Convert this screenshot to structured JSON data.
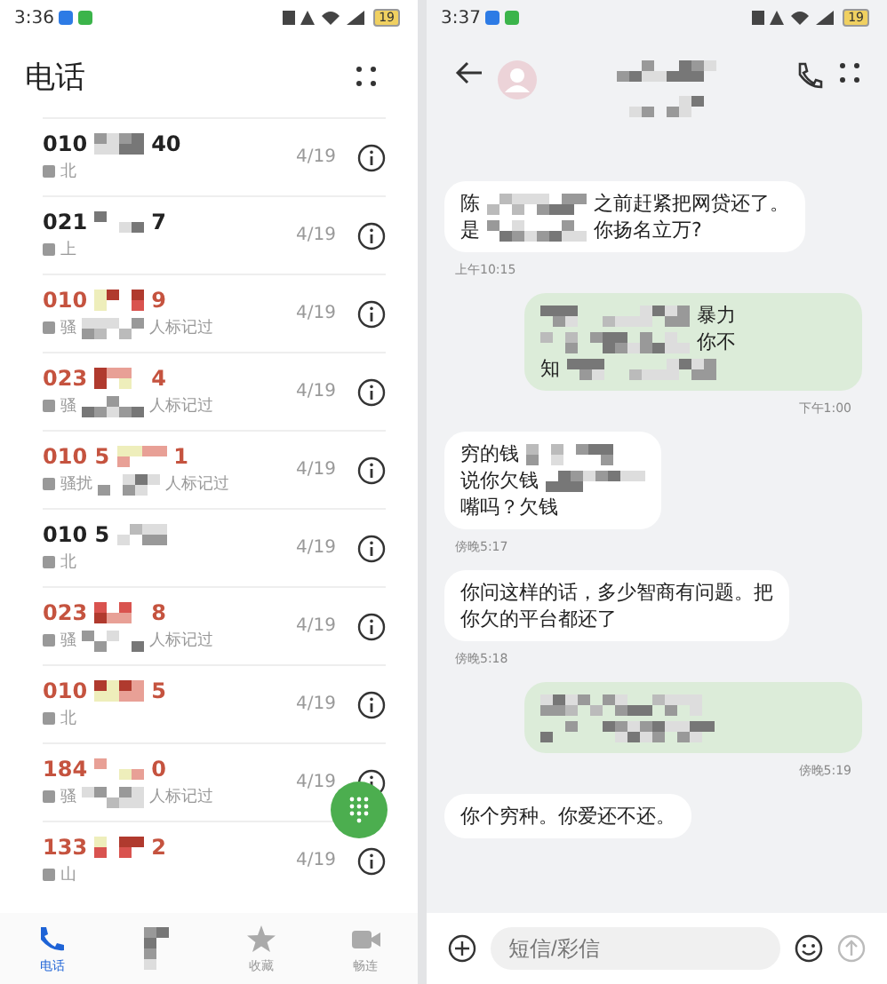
{
  "call_log": {
    "status_bar": {
      "time": "3:36",
      "battery": "19"
    },
    "title": "电话",
    "calls": [
      {
        "number": [
          "010",
          "40"
        ],
        "location": "北",
        "date": "4/19",
        "missed": false
      },
      {
        "number": [
          "021",
          "7"
        ],
        "location": "上",
        "date": "4/19",
        "missed": false
      },
      {
        "number": [
          "010",
          "9"
        ],
        "location": "骚",
        "tag": "人标记过",
        "date": "4/19",
        "missed": true
      },
      {
        "number": [
          "023",
          "4"
        ],
        "location": "骚",
        "tag": "人标记过",
        "date": "4/19",
        "missed": true
      },
      {
        "number": [
          "010 5",
          "1"
        ],
        "location": "骚扰",
        "tag": "人标记过",
        "date": "4/19",
        "missed": true
      },
      {
        "number": [
          "010 5"
        ],
        "location": "北",
        "date": "4/19",
        "missed": false
      },
      {
        "number": [
          "023",
          "8"
        ],
        "location": "骚",
        "tag": "人标记过",
        "date": "4/19",
        "missed": true
      },
      {
        "number": [
          "010",
          "5"
        ],
        "location": "北",
        "date": "4/19",
        "missed": true
      },
      {
        "number": [
          "184",
          "0"
        ],
        "location": "骚",
        "tag": "人标记过",
        "date": "4/19",
        "missed": true
      },
      {
        "number": [
          "133",
          "2"
        ],
        "location": "山",
        "date": "4/19",
        "missed": true
      }
    ],
    "nav": [
      {
        "label": "电话",
        "kind": "phone",
        "selected": true
      },
      {
        "kind": "contacts",
        "selected": false
      },
      {
        "label": "收藏",
        "kind": "star",
        "selected": false
      },
      {
        "label": "畅连",
        "kind": "video",
        "selected": false
      }
    ]
  },
  "conversation": {
    "status_bar": {
      "time": "3:37",
      "battery": "19"
    },
    "messages": [
      {
        "kind": "incoming",
        "lines": [
          [
            {
              "kind": "text",
              "text": "陈"
            },
            {
              "kind": "redacted"
            },
            {
              "kind": "text",
              "text": "之前赶紧把网贷还了。"
            }
          ],
          [
            {
              "kind": "text",
              "text": "是"
            },
            {
              "kind": "redacted"
            },
            {
              "kind": "text",
              "text": "你扬名立万?"
            }
          ]
        ],
        "time": "上午10:15"
      },
      {
        "kind": "outgoing",
        "lines": [
          [
            {
              "kind": "redacted"
            },
            {
              "kind": "text",
              "text": "暴力"
            }
          ],
          [
            {
              "kind": "redacted"
            },
            {
              "kind": "text",
              "text": "你不"
            }
          ],
          [
            {
              "kind": "text",
              "text": "知"
            },
            {
              "kind": "redacted"
            }
          ]
        ],
        "time": "下午1:00"
      },
      {
        "kind": "incoming",
        "lines": [
          [
            {
              "kind": "text",
              "text": "穷的钱"
            },
            {
              "kind": "redacted"
            }
          ],
          [
            {
              "kind": "text",
              "text": "说你欠钱"
            },
            {
              "kind": "redacted"
            }
          ],
          [
            {
              "kind": "text",
              "text": "嘴吗？欠钱"
            }
          ]
        ],
        "time": "傍晚5:17"
      },
      {
        "kind": "incoming",
        "lines": [
          [
            {
              "kind": "text",
              "text": "你问这样的话，多少智商有问题。把"
            }
          ],
          [
            {
              "kind": "text",
              "text": "你欠的平台都还了"
            }
          ]
        ],
        "time": "傍晚5:18"
      },
      {
        "kind": "outgoing",
        "lines": [
          [
            {
              "kind": "redacted"
            }
          ],
          [
            {
              "kind": "redacted"
            }
          ]
        ],
        "time": "傍晚5:19"
      },
      {
        "kind": "incoming",
        "lines": [
          [
            {
              "kind": "text",
              "text": "你个穷种。你爱还不还。"
            }
          ]
        ]
      }
    ],
    "input": {
      "placeholder": "短信/彩信"
    }
  }
}
